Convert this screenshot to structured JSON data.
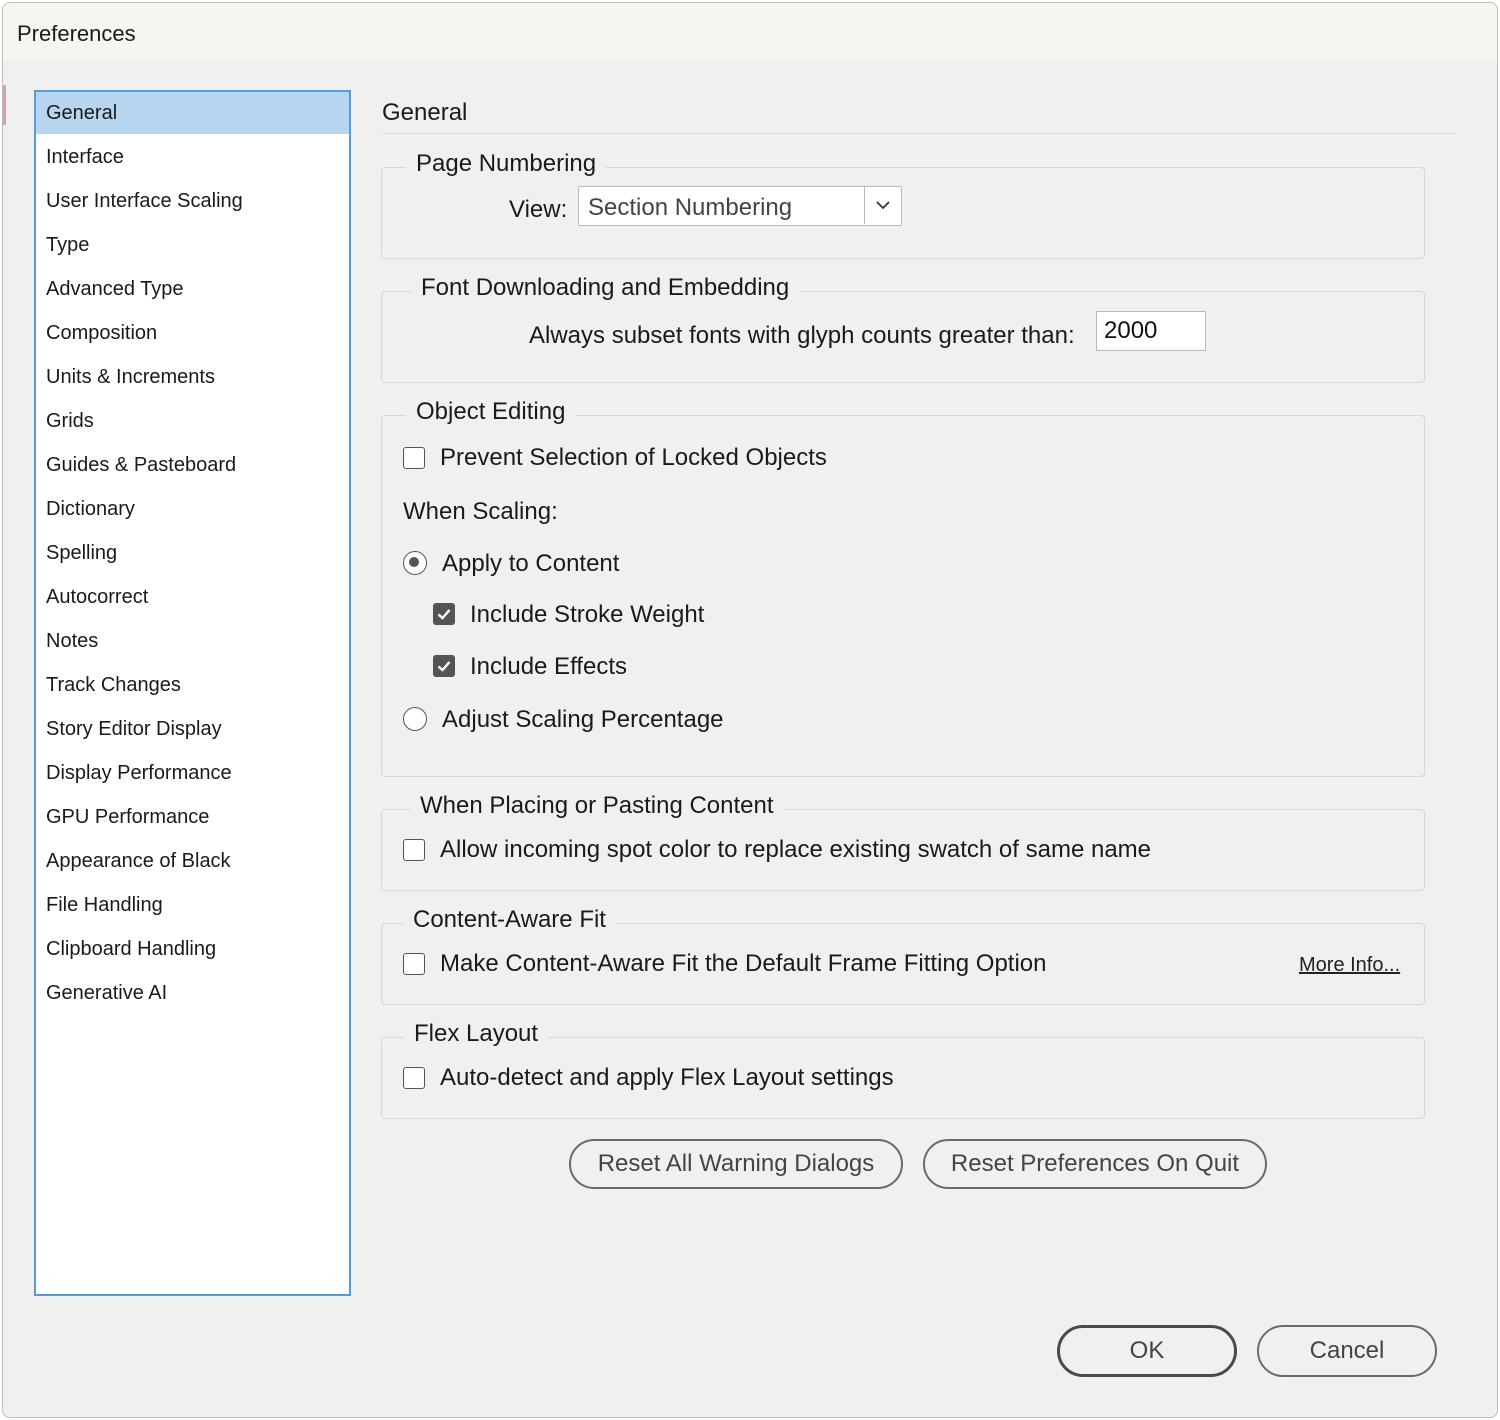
{
  "window": {
    "title": "Preferences"
  },
  "sidebar": {
    "items": [
      {
        "label": "General",
        "selected": true
      },
      {
        "label": "Interface"
      },
      {
        "label": "User Interface Scaling"
      },
      {
        "label": "Type"
      },
      {
        "label": "Advanced Type"
      },
      {
        "label": "Composition"
      },
      {
        "label": "Units & Increments"
      },
      {
        "label": "Grids"
      },
      {
        "label": "Guides & Pasteboard"
      },
      {
        "label": "Dictionary"
      },
      {
        "label": "Spelling"
      },
      {
        "label": "Autocorrect"
      },
      {
        "label": "Notes"
      },
      {
        "label": "Track Changes"
      },
      {
        "label": "Story Editor Display"
      },
      {
        "label": "Display Performance"
      },
      {
        "label": "GPU Performance"
      },
      {
        "label": "Appearance of Black"
      },
      {
        "label": "File Handling"
      },
      {
        "label": "Clipboard Handling"
      },
      {
        "label": "Generative AI"
      }
    ]
  },
  "main": {
    "heading": "General",
    "page_numbering": {
      "legend": "Page Numbering",
      "view_label": "View:",
      "view_value": "Section Numbering"
    },
    "font_downloading": {
      "legend": "Font Downloading and Embedding",
      "subset_label": "Always subset fonts with glyph counts greater than:",
      "subset_value": "2000"
    },
    "object_editing": {
      "legend": "Object Editing",
      "prevent_selection": {
        "label": "Prevent Selection of Locked Objects",
        "checked": false
      },
      "when_scaling_label": "When Scaling:",
      "apply_to_content": {
        "label": "Apply to Content",
        "selected": true
      },
      "include_stroke_weight": {
        "label": "Include Stroke Weight",
        "checked": true
      },
      "include_effects": {
        "label": "Include Effects",
        "checked": true
      },
      "adjust_scaling": {
        "label": "Adjust Scaling Percentage",
        "selected": false
      }
    },
    "placing_pasting": {
      "legend": "When Placing or Pasting Content",
      "allow_spot_color": {
        "label": "Allow incoming spot color to replace existing swatch of same name",
        "checked": false
      }
    },
    "content_aware_fit": {
      "legend": "Content-Aware Fit",
      "make_default": {
        "label": "Make Content-Aware Fit the Default Frame Fitting Option",
        "checked": false
      },
      "more_info": "More Info..."
    },
    "flex_layout": {
      "legend": "Flex Layout",
      "auto_detect": {
        "label": "Auto-detect and apply Flex Layout settings",
        "checked": false
      }
    },
    "buttons": {
      "reset_warnings": "Reset All Warning Dialogs",
      "reset_prefs": "Reset Preferences On Quit"
    }
  },
  "footer": {
    "ok": "OK",
    "cancel": "Cancel"
  },
  "colors": {
    "selection": "#b8d5f0",
    "sidebar_border": "#5b9bd5",
    "dialog_bg": "#f0f0f0"
  },
  "icons": {
    "dropdown": "chevron-down-icon",
    "check": "checkmark-icon"
  }
}
